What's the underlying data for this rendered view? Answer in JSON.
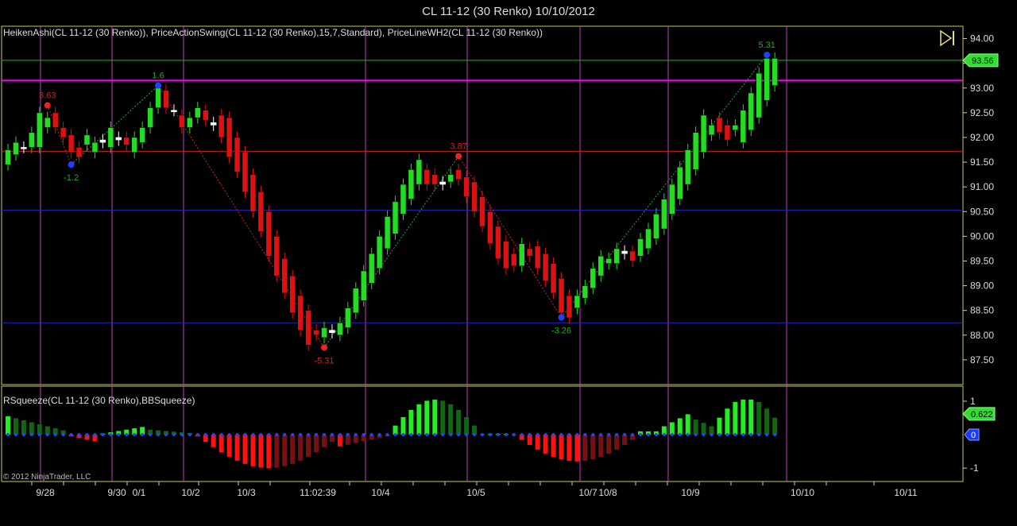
{
  "window_title": "CL 11-12 (30 Renko)  10/10/2012",
  "price_panel": {
    "indicator_label": "HeikenAshi(CL 11-12  (30 Renko)),  PriceActionSwing(CL 11-12  (30 Renko),15,7,Standard),  PriceLineWH2(CL 11-12  (30 Renko))",
    "current_price_tag": "93.56",
    "play_icon": "skip-to-end-icon",
    "ylim": [
      87.0,
      94.25
    ],
    "yticks": [
      "94.00",
      "93.50",
      "93.00",
      "92.50",
      "92.00",
      "91.50",
      "91.00",
      "90.50",
      "90.00",
      "89.50",
      "89.00",
      "88.50",
      "88.00",
      "87.50"
    ],
    "hlines": [
      {
        "price": 93.56,
        "color": "#00cc00"
      },
      {
        "price": 93.15,
        "color": "#ff00ff"
      },
      {
        "price": 91.72,
        "color": "#cc2222"
      },
      {
        "price": 90.53,
        "color": "#2222cc"
      },
      {
        "price": 88.25,
        "color": "#2222cc"
      }
    ],
    "swing_labels": [
      {
        "text": "3.63",
        "color": "#cc2222"
      },
      {
        "text": "-1.2",
        "color": "#22aa22"
      },
      {
        "text": "1.6",
        "color": "#22aa22"
      },
      {
        "text": "-5.31",
        "color": "#cc2222"
      },
      {
        "text": "3.87",
        "color": "#cc2222"
      },
      {
        "text": "-3.26",
        "color": "#22aa22"
      },
      {
        "text": "5.31",
        "color": "#22aa22"
      }
    ]
  },
  "squeeze_panel": {
    "indicator_label": "RSqueeze(CL 11-12 (30 Renko),BBSqueeze)",
    "value_tag": "0.622",
    "zero_tag": "0",
    "ylim": [
      -1.4,
      1.45
    ],
    "yticks": [
      "1",
      "-1"
    ]
  },
  "copyright": "© 2012 NinjaTrader, LLC",
  "x_axis": {
    "labels": [
      "9/28",
      "9/30",
      "0/1",
      "10/2",
      "10/3",
      "11:02:39",
      "10/4",
      "10/5",
      "10/7",
      "10/8",
      "10/9",
      "10/10",
      "10/11"
    ]
  },
  "colors": {
    "up": "#22dd22",
    "down": "#dd1111",
    "doji": "#ffffff",
    "frame": "#c8c864",
    "vline": "#c040c0"
  },
  "chart_data": {
    "type": "candlestick",
    "title": "CL 11-12 (30 Renko)  10/10/2012",
    "renko_brick": 0.3,
    "open": [
      91.45,
      91.65,
      91.8,
      91.8,
      91.8,
      92.2,
      92.5,
      92.2,
      92.05,
      91.8,
      91.85,
      91.7,
      91.95,
      91.8,
      91.95,
      92.0,
      91.7,
      91.9,
      92.2,
      92.6,
      92.95,
      92.55,
      92.45,
      92.2,
      92.4,
      92.55,
      92.3,
      92.45,
      92.4,
      92.0,
      91.7,
      91.25,
      90.9,
      90.5,
      90.0,
      89.55,
      89.2,
      88.8,
      88.5,
      88.1,
      87.95,
      88.05,
      88.0,
      88.15,
      88.45,
      88.7,
      89.05,
      89.35,
      89.75,
      90.05,
      90.45,
      90.75,
      91.05,
      91.35,
      91.25,
      91.05,
      91.1,
      91.35,
      91.2,
      91.1,
      90.8,
      90.5,
      90.2,
      89.9,
      89.65,
      89.4,
      89.75,
      89.8,
      89.65,
      89.45,
      89.15,
      88.8,
      88.55,
      88.75,
      88.95,
      89.2,
      89.45,
      89.45,
      89.65,
      89.7,
      89.6,
      89.75,
      89.95,
      90.15,
      90.45,
      90.75,
      91.05,
      91.35,
      91.7,
      92.05,
      92.4,
      92.25,
      92.15,
      91.9,
      92.15,
      92.4,
      92.75,
      93.05
    ],
    "close": [
      91.75,
      91.9,
      91.8,
      92.1,
      92.5,
      92.4,
      92.2,
      92.0,
      91.7,
      91.6,
      92.05,
      91.9,
      91.9,
      92.2,
      92.0,
      91.85,
      92.0,
      92.2,
      92.6,
      93.0,
      92.6,
      92.55,
      92.2,
      92.4,
      92.6,
      92.35,
      92.25,
      92.0,
      91.6,
      91.3,
      90.9,
      90.5,
      90.1,
      89.6,
      89.2,
      88.85,
      88.45,
      88.1,
      87.8,
      88.0,
      88.15,
      88.1,
      88.25,
      88.55,
      88.95,
      89.3,
      89.65,
      90.0,
      90.4,
      90.7,
      91.05,
      91.35,
      91.55,
      91.05,
      91.05,
      91.1,
      91.25,
      91.15,
      90.8,
      90.5,
      90.2,
      89.85,
      89.55,
      89.35,
      89.4,
      89.85,
      89.6,
      89.35,
      89.1,
      88.85,
      88.45,
      88.35,
      88.8,
      89.0,
      89.35,
      89.6,
      89.55,
      89.75,
      89.7,
      89.5,
      89.95,
      90.15,
      90.45,
      90.75,
      91.05,
      91.4,
      91.75,
      92.1,
      92.45,
      92.25,
      92.1,
      91.95,
      92.25,
      92.55,
      92.9,
      93.3,
      93.6,
      93.6
    ],
    "swings": [
      {
        "price": 92.65,
        "value": 3.63,
        "type": "high"
      },
      {
        "price": 91.45,
        "value": -1.2,
        "type": "low"
      },
      {
        "price": 93.05,
        "value": 1.6,
        "type": "high"
      },
      {
        "price": 87.75,
        "value": -5.31,
        "type": "low"
      },
      {
        "price": 91.62,
        "value": 3.87,
        "type": "high"
      },
      {
        "price": 88.36,
        "value": -3.26,
        "type": "low"
      },
      {
        "price": 93.67,
        "value": 5.31,
        "type": "high"
      }
    ]
  }
}
